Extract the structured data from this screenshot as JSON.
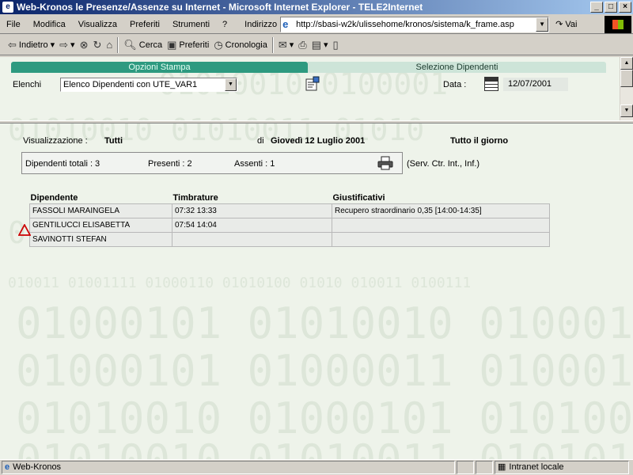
{
  "window": {
    "title": "Web-Kronos le Presenze/Assenze su Internet - Microsoft Internet Explorer - TELE2Internet",
    "buttons": {
      "minimize": "_",
      "maximize": "□",
      "close": "×"
    }
  },
  "menu": {
    "items": [
      {
        "label": "File"
      },
      {
        "label": "Modifica"
      },
      {
        "label": "Visualizza"
      },
      {
        "label": "Preferiti"
      },
      {
        "label": "Strumenti"
      },
      {
        "label": "?"
      }
    ],
    "address_label": "Indirizzo",
    "address_value": "http://sbasi-w2k/ulissehome/kronos/sistema/k_frame.asp",
    "go_label": "Vai"
  },
  "toolbar": {
    "back_label": "Indietro",
    "search_label": "Cerca",
    "favorites_label": "Preferiti",
    "history_label": "Cronologia"
  },
  "top_frame": {
    "tab_left": "Opzioni Stampa",
    "tab_right": "Selezione Dipendenti",
    "elenchi_label": "Elenchi",
    "elenchi_value": "Elenco Dipendenti con UTE_VAR1",
    "data_label": "Data :",
    "data_value": "12/07/2001"
  },
  "report": {
    "visualizzazione_label": "Visualizzazione :",
    "visualizzazione_value": "Tutti",
    "di_label": "di",
    "date_long": "Giovedì 12 Luglio 2001",
    "period": "Tutto il giorno",
    "totali": "Dipendenti totali : 3",
    "presenti": "Presenti : 2",
    "assenti": "Assenti : 1",
    "service_note": "(Serv. Ctr. Int., Inf.)",
    "columns": [
      "Dipendente",
      "Timbrature",
      "Giustificativi"
    ],
    "rows": [
      {
        "name": "FASSOLI MARAINGELA",
        "timbrature": "07:32 13:33",
        "giustificativi": "Recupero straordinario  0,35   [14:00-14:35]"
      },
      {
        "name": "GENTILUCCI ELISABETTA",
        "timbrature": "07:54 14:04",
        "giustificativi": ""
      },
      {
        "name": "SAVINOTTI STEFAN",
        "timbrature": "",
        "giustificativi": ""
      }
    ]
  },
  "status": {
    "left": "Web-Kronos",
    "zone": "Intranet locale"
  },
  "colors": {
    "tab_active": "#2e9a80",
    "tab_inactive": "#cde4d8",
    "page_bg": "#eef3ea",
    "warning": "#cc0000"
  }
}
